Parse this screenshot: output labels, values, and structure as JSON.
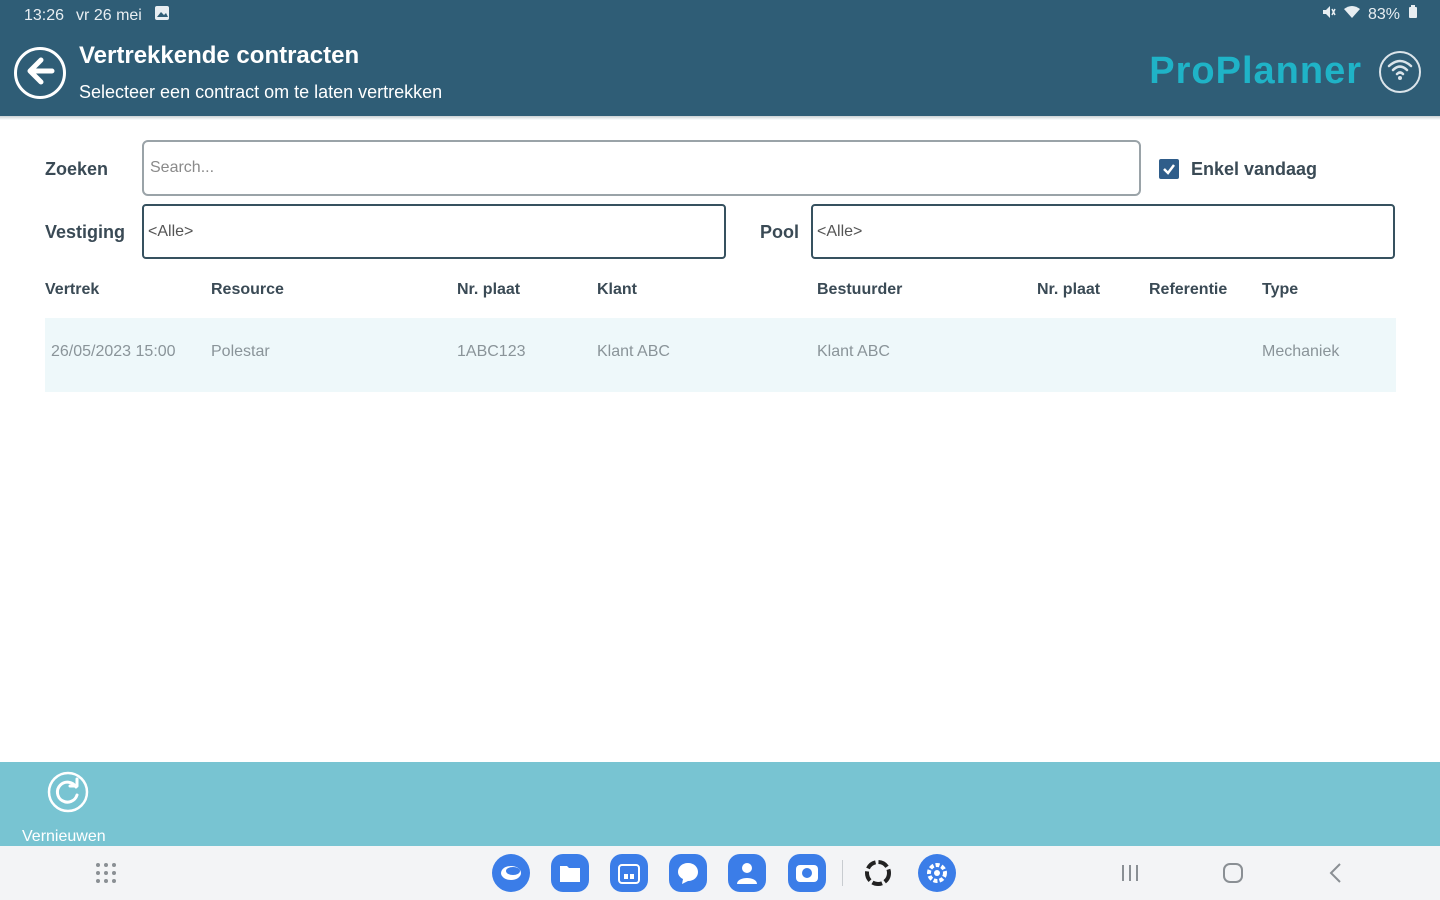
{
  "status_bar": {
    "time": "13:26",
    "date": "vr 26 mei",
    "battery": "83%"
  },
  "header": {
    "title": "Vertrekkende contracten",
    "subtitle": "Selecteer een contract om te laten vertrekken",
    "brand": "ProPlanner"
  },
  "filters": {
    "search_label": "Zoeken",
    "search_placeholder": "Search...",
    "today_only_label": "Enkel vandaag",
    "today_only_checked": true,
    "branch_label": "Vestiging",
    "branch_value": "<Alle>",
    "pool_label": "Pool",
    "pool_value": "<Alle>"
  },
  "table": {
    "columns": [
      "Vertrek",
      "Resource",
      "Nr. plaat",
      "Klant",
      "Bestuurder",
      "Nr. plaat",
      "Referentie",
      "Type"
    ],
    "rows": [
      [
        "26/05/2023 15:00",
        "Polestar",
        "1ABC123",
        "Klant ABC",
        "Klant ABC",
        "",
        "",
        "Mechaniek"
      ]
    ]
  },
  "bottom_bar": {
    "refresh_label": "Vernieuwen"
  },
  "colors": {
    "header_bg": "#2f5d76",
    "brand": "#1fb3c7",
    "bottom_bar_bg": "#78c4d2",
    "row_bg": "#eef8fa",
    "checkbox": "#2f5d8a"
  },
  "icons": [
    "back-arrow-icon",
    "wifi-icon",
    "refresh-icon",
    "gallery-icon",
    "mute-icon",
    "battery-icon"
  ]
}
